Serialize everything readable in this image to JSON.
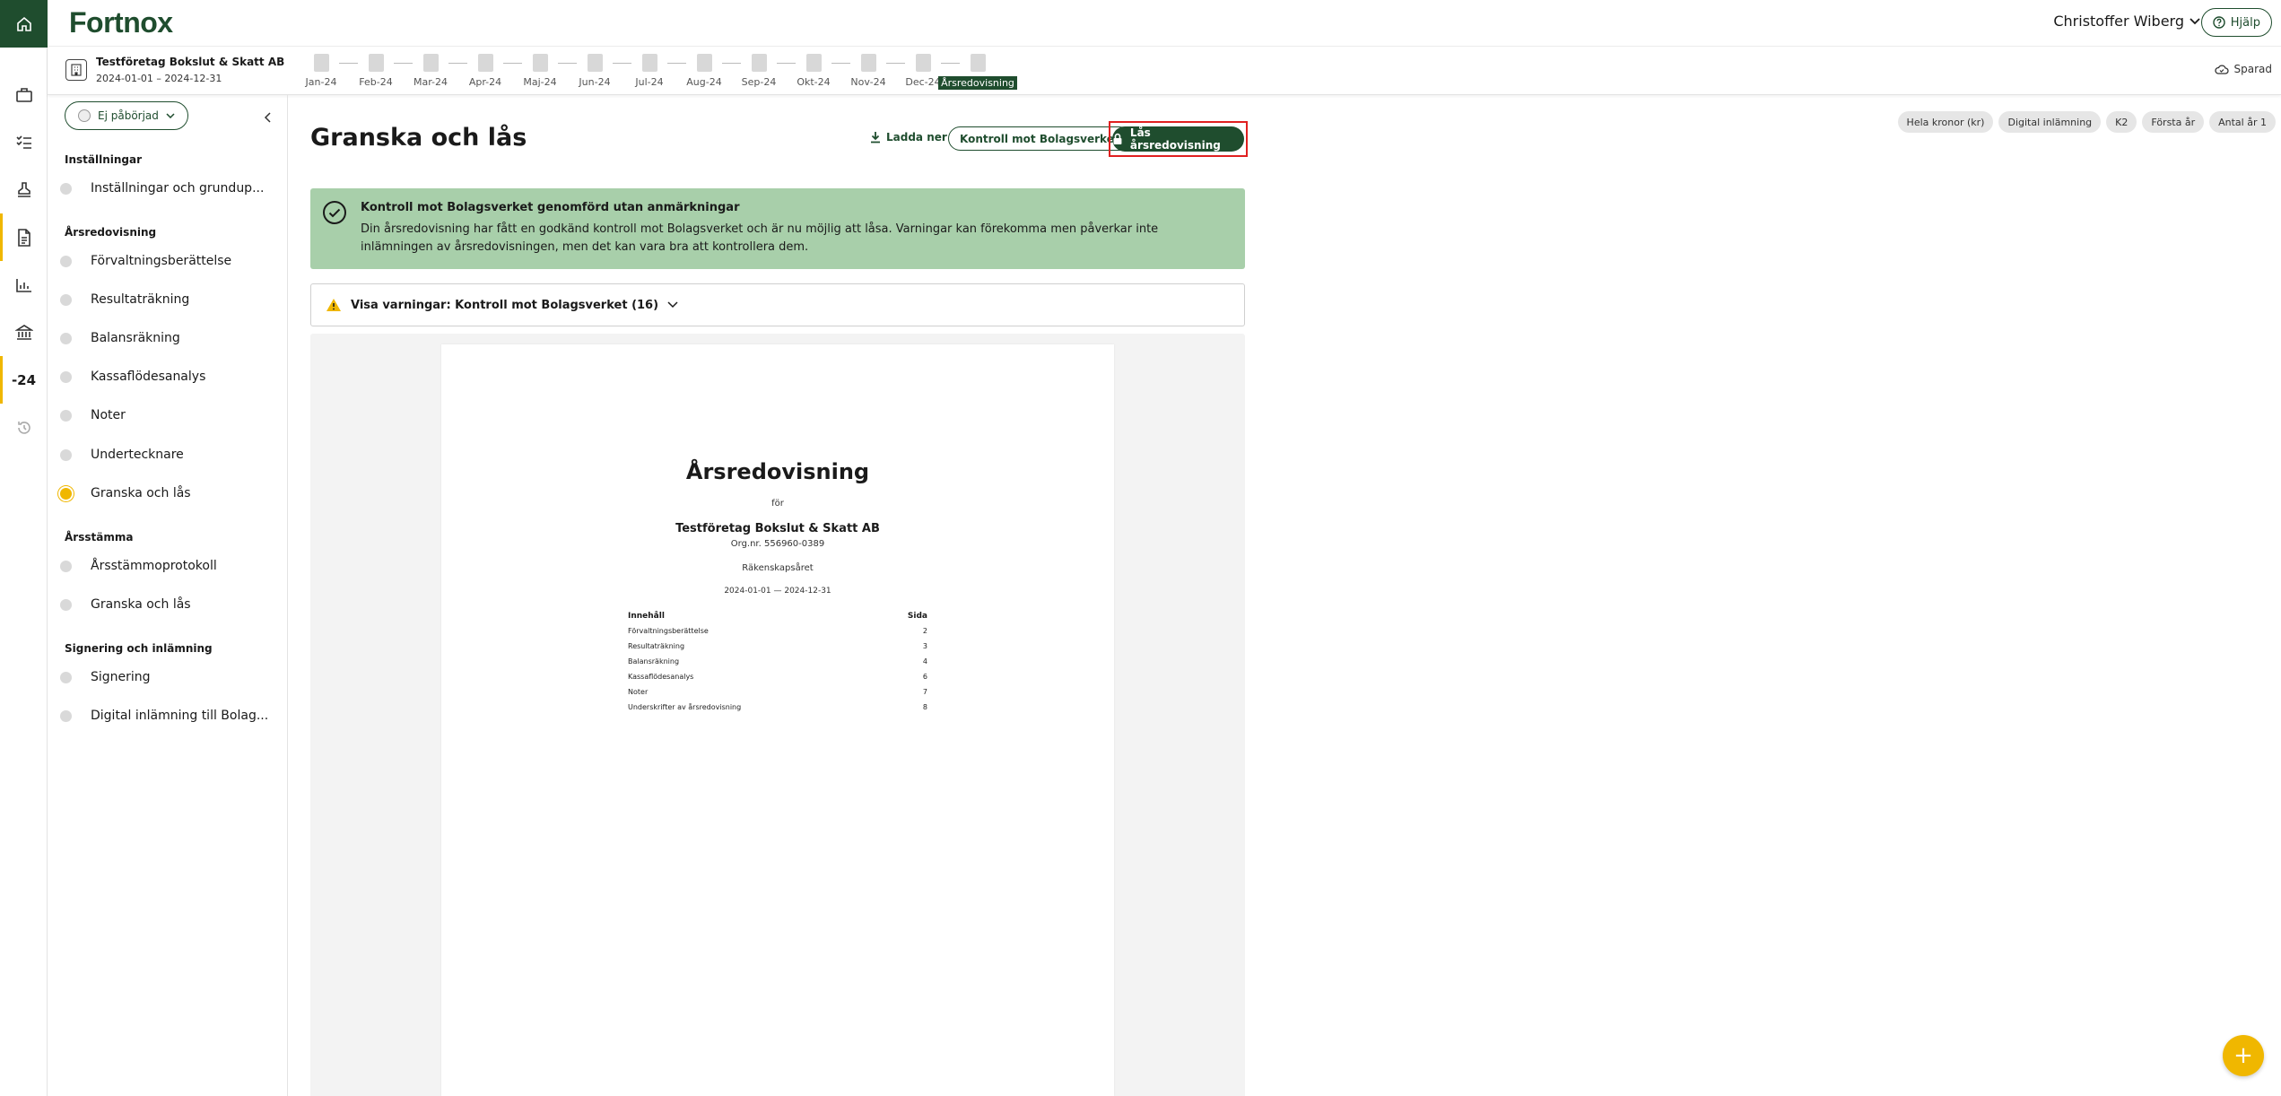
{
  "app": {
    "brand": "Fortnox",
    "user_name": "Christoffer Wiberg",
    "help_label": "Hjälp",
    "saved_label": "Sparad"
  },
  "rail": {
    "year_label": "-24"
  },
  "company": {
    "name": "Testföretag Bokslut & Skatt AB",
    "dates": "2024-01-01 – 2024-12-31"
  },
  "periods": [
    "Jan-24",
    "Feb-24",
    "Mar-24",
    "Apr-24",
    "Maj-24",
    "Jun-24",
    "Jul-24",
    "Aug-24",
    "Sep-24",
    "Okt-24",
    "Nov-24",
    "Dec-24",
    "Årsredovisning"
  ],
  "sidebar": {
    "status_label": "Ej påbörjad",
    "sections": [
      {
        "title": "Inställningar",
        "items": [
          "Inställningar och grundup..."
        ]
      },
      {
        "title": "Årsredovisning",
        "items": [
          "Förvaltningsberättelse",
          "Resultaträkning",
          "Balansräkning",
          "Kassaflödesanalys",
          "Noter",
          "Undertecknare",
          "Granska och lås"
        ]
      },
      {
        "title": "Årsstämma",
        "items": [
          "Årsstämmoprotokoll",
          "Granska och lås"
        ]
      },
      {
        "title": "Signering och inlämning",
        "items": [
          "Signering",
          "Digital inlämning till Bolag..."
        ]
      }
    ]
  },
  "main": {
    "title": "Granska och lås",
    "download_label": "Ladda ner",
    "check_label": "Kontroll mot Bolagsverket",
    "lock_label": "Lås årsredovisning",
    "chips": [
      "Hela kronor (kr)",
      "Digital inlämning",
      "K2",
      "Första år",
      "Antal år 1"
    ],
    "alert_title": "Kontroll mot Bolagsverket genomförd utan anmärkningar",
    "alert_text": "Din årsredovisning har fått en godkänd kontroll mot Bolagsverket och är nu möjlig att låsa. Varningar kan förekomma men påverkar inte inlämningen av årsredovisningen, men det kan vara bra att kontrollera dem.",
    "warnings_label": "Visa varningar: Kontroll mot Bolagsverket (16)"
  },
  "document": {
    "title": "Årsredovisning",
    "for": "för",
    "company": "Testföretag Bokslut & Skatt AB",
    "orgnr": "Org.nr. 556960-0389",
    "year_label": "Räkenskapsåret",
    "period": "2024-01-01 — 2024-12-31",
    "toc_head": [
      "Innehåll",
      "Sida"
    ],
    "toc": [
      [
        "Förvaltningsberättelse",
        "2"
      ],
      [
        "Resultaträkning",
        "3"
      ],
      [
        "Balansräkning",
        "4"
      ],
      [
        "Kassaflödesanalys",
        "6"
      ],
      [
        "Noter",
        "7"
      ],
      [
        "Underskrifter av årsredovisning",
        "8"
      ]
    ]
  },
  "colors": {
    "brand_green": "#1f4d2e",
    "accent_yellow": "#f0b700",
    "alert_bg": "#a8cfaa",
    "highlight_red": "#e02020"
  }
}
